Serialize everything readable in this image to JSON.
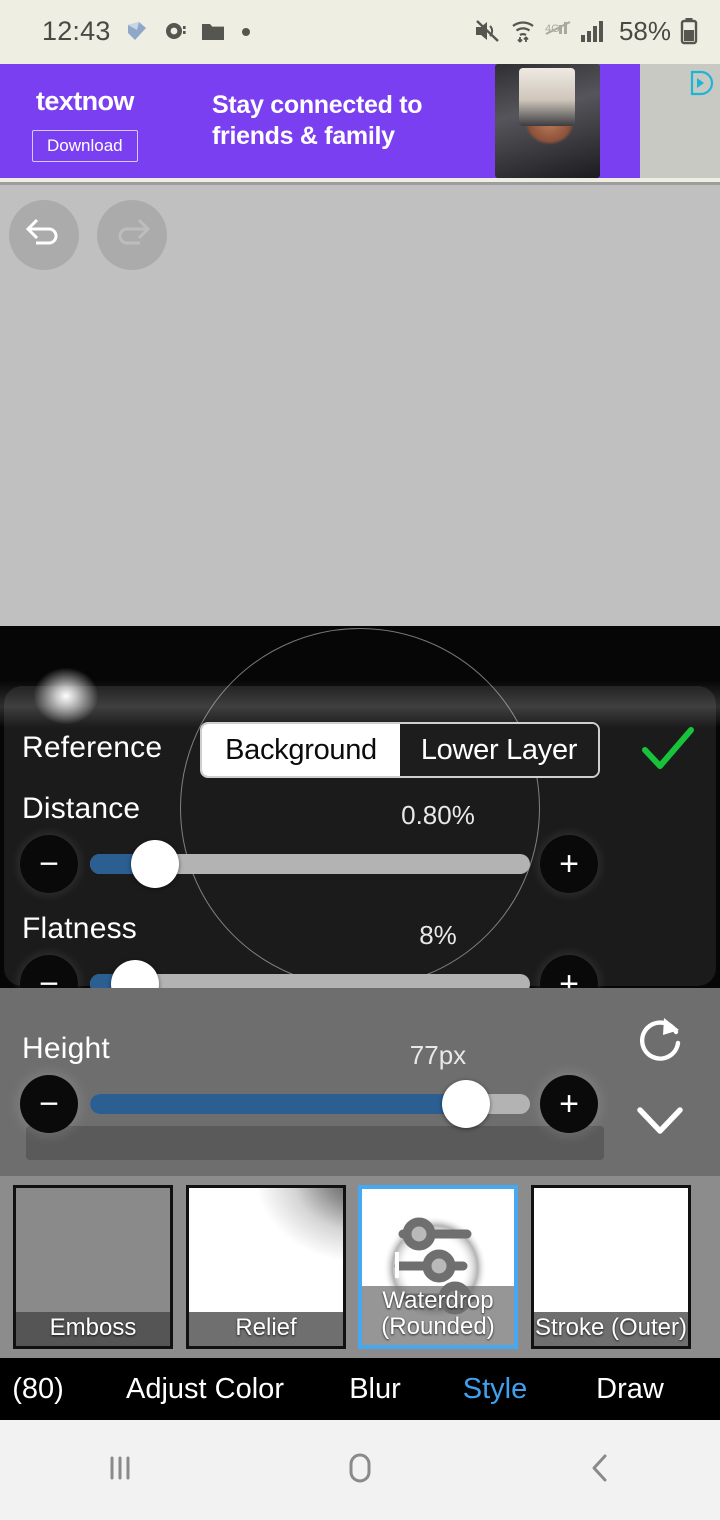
{
  "status_bar": {
    "clock": "12:43",
    "battery_percent": "58%",
    "left_icons": [
      "app-notification-icon",
      "camera-notification-icon",
      "folder-notification-icon",
      "dot-notification-icon"
    ],
    "right_icons": [
      "mute-icon",
      "wifi-icon",
      "mobile-data-off-icon",
      "signal-bars-icon",
      "battery-icon"
    ]
  },
  "ad": {
    "brand_text": "text",
    "brand_bold": "now",
    "download_label": "Download",
    "headline_line1": "Stay connected to",
    "headline_line2": "friends & family",
    "adchoices_icon": "adchoices-icon",
    "background_color": "#7b3ff2"
  },
  "canvas": {
    "undo_label": "undo-arrow",
    "redo_label": "redo-arrow",
    "background_color": "#c0c0c0"
  },
  "effect_panel": {
    "reference": {
      "label": "Reference",
      "options": [
        "Background",
        "Lower Layer"
      ],
      "selected": "Background"
    },
    "confirm_icon": "check-icon",
    "reset_icon": "reset-icon",
    "collapse_icon": "chevron-down-icon",
    "sliders": [
      {
        "label": "Distance",
        "value": "0.80%",
        "fill_percent": 14,
        "minus": "−",
        "plus": "+"
      },
      {
        "label": "Flatness",
        "value": "8%",
        "fill_percent": 9,
        "minus": "−",
        "plus": "+"
      },
      {
        "label": "Height",
        "value": "77px",
        "fill_percent": 84,
        "minus": "−",
        "plus": "+"
      }
    ]
  },
  "presets": {
    "items": [
      {
        "label": "Emboss",
        "selected": false,
        "thumb": "t-emboss"
      },
      {
        "label": "Relief",
        "selected": false,
        "thumb": "t-relief"
      },
      {
        "label": "Waterdrop\n(Rounded)",
        "selected": true,
        "thumb": "t-water"
      },
      {
        "label": "Stroke (Outer)",
        "selected": false,
        "thumb": "t-stroke"
      }
    ],
    "selected_accent": "#45a8f0"
  },
  "bottom_tabs": {
    "items": [
      {
        "label": "(80)",
        "active": false
      },
      {
        "label": "Adjust Color",
        "active": false
      },
      {
        "label": "Blur",
        "active": false
      },
      {
        "label": "Style",
        "active": true
      },
      {
        "label": "Draw",
        "active": false
      }
    ],
    "active_color": "#3fa1ee"
  },
  "nav_bar": {
    "recents_icon": "recents-icon",
    "home_icon": "home-icon",
    "back_icon": "back-icon"
  }
}
